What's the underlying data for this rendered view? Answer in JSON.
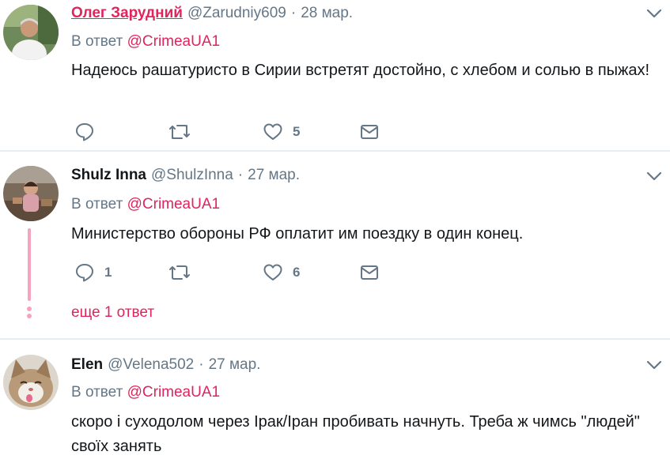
{
  "tweets": [
    {
      "author_name": "Олег Зарудний",
      "author_handle": "@Zarudniy609",
      "date": "28 мар.",
      "reply_prefix": "В ответ",
      "reply_handle": "@CrimeaUA1",
      "text": "Надеюсь рашатуристо в Сирии встретят достойно, с хлебом и солью в пыжах!",
      "reply_count": "",
      "retweet_count": "",
      "like_count": "5"
    },
    {
      "author_name": "Shulz Inna",
      "author_handle": "@ShulzInna",
      "date": "27 мар.",
      "reply_prefix": "В ответ",
      "reply_handle": "@CrimeaUA1",
      "text": "Министерство обороны РФ оплатит им поездку в один конец.",
      "reply_count": "1",
      "retweet_count": "",
      "like_count": "6",
      "more_replies": "еще 1 ответ"
    },
    {
      "author_name": "Elen",
      "author_handle": "@Velena502",
      "date": "27 мар.",
      "reply_prefix": "В ответ",
      "reply_handle": "@CrimeaUA1",
      "text": "скоро і суходолом через Ірак/Іран пробивать начнуть. Треба ж чимсь \"людей\" своїх занять"
    }
  ],
  "colors": {
    "accent": "#e0245e",
    "secondary_text": "#657786",
    "divider": "#e6ecf0",
    "thread_line": "#f5a3c0"
  },
  "icons": [
    "reply-icon",
    "retweet-icon",
    "like-icon",
    "direct-message-icon",
    "chevron-down-icon"
  ]
}
